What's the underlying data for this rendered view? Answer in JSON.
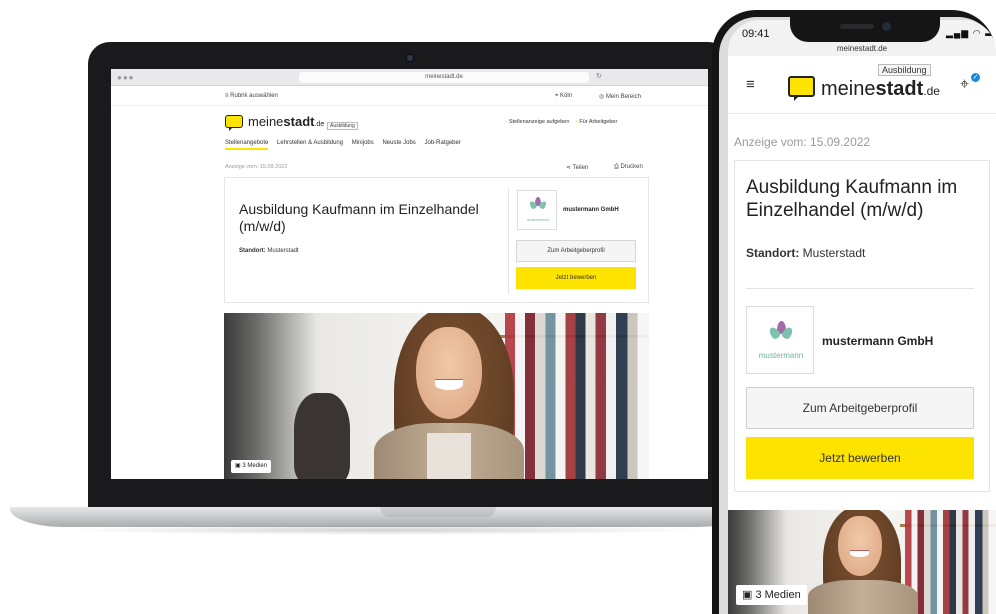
{
  "laptop": {
    "browser": {
      "url": "meinestadt.de",
      "window_controls": "●●●"
    },
    "topnav": {
      "rubrik": "Rubrik auswählen",
      "city": "Köln",
      "account": "Mein Bereich"
    },
    "logo": {
      "meine": "meine",
      "stadt": "stadt",
      "tld": ".de",
      "badge": "Ausbildung"
    },
    "header_links": {
      "post_job": "Stellenanzeige aufgeben",
      "employers": "Für Arbeitgeber"
    },
    "menu": [
      "Stellenangebote",
      "Lehrstellen & Ausbildung",
      "Minijobs",
      "Neuste Jobs",
      "Job-Ratgeber"
    ],
    "meta": "Anzeige vom: 15.09.2022",
    "actions": {
      "share": "Teilen",
      "print": "Drucken"
    },
    "job": {
      "title": "Ausbildung Kaufmann im Einzelhandel (m/w/d)",
      "location_label": "Standort:",
      "location_value": "Musterstadt"
    },
    "employer": {
      "name": "mustermann GmbH",
      "logo_text": "mustermann"
    },
    "buttons": {
      "profile": "Zum Arbeitgeberprofil",
      "apply": "Jetzt bewerben"
    },
    "media": "3 Medien"
  },
  "phone": {
    "status": {
      "time": "09:41",
      "url": "meinestadt.de"
    },
    "logo": {
      "meine": "meine",
      "stadt": "stadt",
      "tld": ".de",
      "badge": "Ausbildung"
    },
    "meta": "Anzeige vom: 15.09.2022",
    "job": {
      "title": "Ausbildung Kaufmann im Einzelhandel (m/w/d)",
      "location_label": "Standort:",
      "location_value": "Musterstadt"
    },
    "employer": {
      "name": "mustermann GmbH",
      "logo_text": "mustermann"
    },
    "buttons": {
      "profile": "Zum Arbeitgeberprofil",
      "apply": "Jetzt bewerben"
    },
    "media": "3 Medien"
  },
  "colors": {
    "brand_yellow": "#fde300",
    "text_dark": "#222222",
    "lotus_green": "#6fb3a5",
    "lotus_purple": "#a46aa8"
  },
  "icons": [
    "hamburger-icon",
    "location-pin-icon",
    "user-icon",
    "share-icon",
    "print-icon",
    "image-icon",
    "signal-icon",
    "wifi-icon",
    "battery-icon"
  ]
}
